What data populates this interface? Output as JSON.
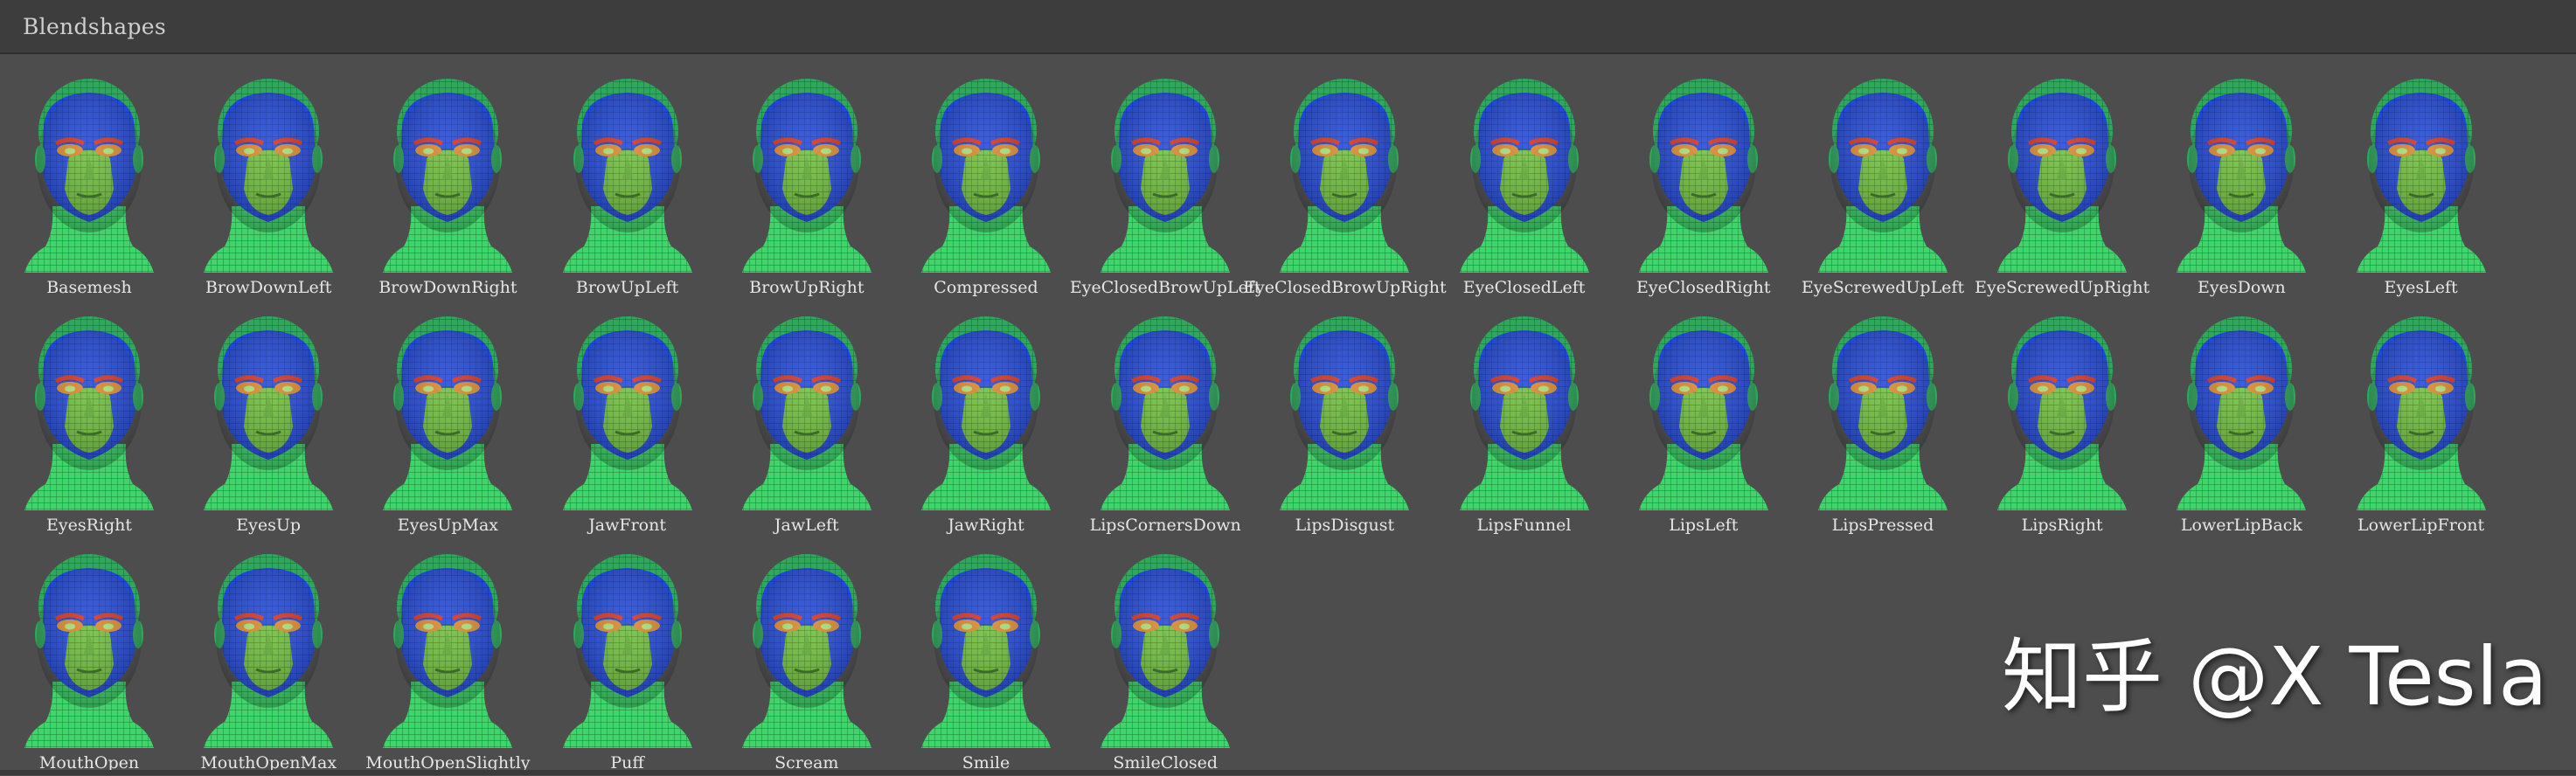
{
  "panel": {
    "title": "Blendshapes"
  },
  "watermark": "知乎 @X Tesla",
  "colors": {
    "background": "#4d4d4d",
    "header": "#3d3d3d",
    "skin_blue": "#2148d8",
    "skin_green": "#6fbf3a",
    "neck_green": "#3fd56a",
    "brow_red": "#d0321e"
  },
  "blendshapes": [
    {
      "label": "Basemesh",
      "icon": "head-mesh-icon"
    },
    {
      "label": "BrowDownLeft",
      "icon": "head-mesh-icon"
    },
    {
      "label": "BrowDownRight",
      "icon": "head-mesh-icon"
    },
    {
      "label": "BrowUpLeft",
      "icon": "head-mesh-icon"
    },
    {
      "label": "BrowUpRight",
      "icon": "head-mesh-icon"
    },
    {
      "label": "Compressed",
      "icon": "head-mesh-icon"
    },
    {
      "label": "EyeClosedBrowUpLeft",
      "icon": "head-mesh-icon"
    },
    {
      "label": "EyeClosedBrowUpRight",
      "icon": "head-mesh-icon"
    },
    {
      "label": "EyeClosedLeft",
      "icon": "head-mesh-icon"
    },
    {
      "label": "EyeClosedRight",
      "icon": "head-mesh-icon"
    },
    {
      "label": "EyeScrewedUpLeft",
      "icon": "head-mesh-icon"
    },
    {
      "label": "EyeScrewedUpRight",
      "icon": "head-mesh-icon"
    },
    {
      "label": "EyesDown",
      "icon": "head-mesh-icon"
    },
    {
      "label": "EyesLeft",
      "icon": "head-mesh-icon"
    },
    {
      "label": "EyesRight",
      "icon": "head-mesh-icon"
    },
    {
      "label": "EyesUp",
      "icon": "head-mesh-icon"
    },
    {
      "label": "EyesUpMax",
      "icon": "head-mesh-icon"
    },
    {
      "label": "JawFront",
      "icon": "head-mesh-icon"
    },
    {
      "label": "JawLeft",
      "icon": "head-mesh-icon"
    },
    {
      "label": "JawRight",
      "icon": "head-mesh-icon"
    },
    {
      "label": "LipsCornersDown",
      "icon": "head-mesh-icon"
    },
    {
      "label": "LipsDisgust",
      "icon": "head-mesh-icon"
    },
    {
      "label": "LipsFunnel",
      "icon": "head-mesh-icon"
    },
    {
      "label": "LipsLeft",
      "icon": "head-mesh-icon"
    },
    {
      "label": "LipsPressed",
      "icon": "head-mesh-icon"
    },
    {
      "label": "LipsRight",
      "icon": "head-mesh-icon"
    },
    {
      "label": "LowerLipBack",
      "icon": "head-mesh-icon"
    },
    {
      "label": "LowerLipFront",
      "icon": "head-mesh-icon"
    },
    {
      "label": "MouthOpen",
      "icon": "head-mesh-icon"
    },
    {
      "label": "MouthOpenMax",
      "icon": "head-mesh-icon"
    },
    {
      "label": "MouthOpenSlightly",
      "icon": "head-mesh-icon"
    },
    {
      "label": "Puff",
      "icon": "head-mesh-icon"
    },
    {
      "label": "Scream",
      "icon": "head-mesh-icon"
    },
    {
      "label": "Smile",
      "icon": "head-mesh-icon"
    },
    {
      "label": "SmileClosed",
      "icon": "head-mesh-icon"
    }
  ]
}
